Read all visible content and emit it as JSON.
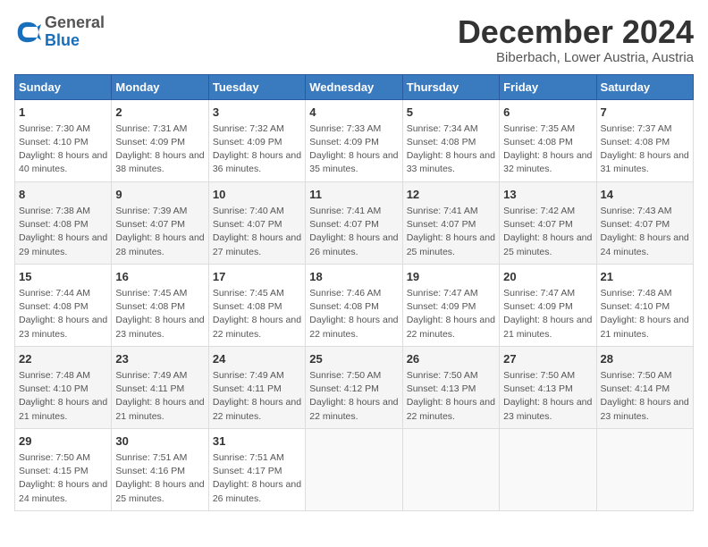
{
  "header": {
    "logo": {
      "general": "General",
      "blue": "Blue"
    },
    "title": "December 2024",
    "subtitle": "Biberbach, Lower Austria, Austria"
  },
  "calendar": {
    "days_of_week": [
      "Sunday",
      "Monday",
      "Tuesday",
      "Wednesday",
      "Thursday",
      "Friday",
      "Saturday"
    ],
    "weeks": [
      [
        {
          "day": "1",
          "sunrise": "7:30 AM",
          "sunset": "4:10 PM",
          "daylight": "8 hours and 40 minutes."
        },
        {
          "day": "2",
          "sunrise": "7:31 AM",
          "sunset": "4:09 PM",
          "daylight": "8 hours and 38 minutes."
        },
        {
          "day": "3",
          "sunrise": "7:32 AM",
          "sunset": "4:09 PM",
          "daylight": "8 hours and 36 minutes."
        },
        {
          "day": "4",
          "sunrise": "7:33 AM",
          "sunset": "4:09 PM",
          "daylight": "8 hours and 35 minutes."
        },
        {
          "day": "5",
          "sunrise": "7:34 AM",
          "sunset": "4:08 PM",
          "daylight": "8 hours and 33 minutes."
        },
        {
          "day": "6",
          "sunrise": "7:35 AM",
          "sunset": "4:08 PM",
          "daylight": "8 hours and 32 minutes."
        },
        {
          "day": "7",
          "sunrise": "7:37 AM",
          "sunset": "4:08 PM",
          "daylight": "8 hours and 31 minutes."
        }
      ],
      [
        {
          "day": "8",
          "sunrise": "7:38 AM",
          "sunset": "4:08 PM",
          "daylight": "8 hours and 29 minutes."
        },
        {
          "day": "9",
          "sunrise": "7:39 AM",
          "sunset": "4:07 PM",
          "daylight": "8 hours and 28 minutes."
        },
        {
          "day": "10",
          "sunrise": "7:40 AM",
          "sunset": "4:07 PM",
          "daylight": "8 hours and 27 minutes."
        },
        {
          "day": "11",
          "sunrise": "7:41 AM",
          "sunset": "4:07 PM",
          "daylight": "8 hours and 26 minutes."
        },
        {
          "day": "12",
          "sunrise": "7:41 AM",
          "sunset": "4:07 PM",
          "daylight": "8 hours and 25 minutes."
        },
        {
          "day": "13",
          "sunrise": "7:42 AM",
          "sunset": "4:07 PM",
          "daylight": "8 hours and 25 minutes."
        },
        {
          "day": "14",
          "sunrise": "7:43 AM",
          "sunset": "4:07 PM",
          "daylight": "8 hours and 24 minutes."
        }
      ],
      [
        {
          "day": "15",
          "sunrise": "7:44 AM",
          "sunset": "4:08 PM",
          "daylight": "8 hours and 23 minutes."
        },
        {
          "day": "16",
          "sunrise": "7:45 AM",
          "sunset": "4:08 PM",
          "daylight": "8 hours and 23 minutes."
        },
        {
          "day": "17",
          "sunrise": "7:45 AM",
          "sunset": "4:08 PM",
          "daylight": "8 hours and 22 minutes."
        },
        {
          "day": "18",
          "sunrise": "7:46 AM",
          "sunset": "4:08 PM",
          "daylight": "8 hours and 22 minutes."
        },
        {
          "day": "19",
          "sunrise": "7:47 AM",
          "sunset": "4:09 PM",
          "daylight": "8 hours and 22 minutes."
        },
        {
          "day": "20",
          "sunrise": "7:47 AM",
          "sunset": "4:09 PM",
          "daylight": "8 hours and 21 minutes."
        },
        {
          "day": "21",
          "sunrise": "7:48 AM",
          "sunset": "4:10 PM",
          "daylight": "8 hours and 21 minutes."
        }
      ],
      [
        {
          "day": "22",
          "sunrise": "7:48 AM",
          "sunset": "4:10 PM",
          "daylight": "8 hours and 21 minutes."
        },
        {
          "day": "23",
          "sunrise": "7:49 AM",
          "sunset": "4:11 PM",
          "daylight": "8 hours and 21 minutes."
        },
        {
          "day": "24",
          "sunrise": "7:49 AM",
          "sunset": "4:11 PM",
          "daylight": "8 hours and 22 minutes."
        },
        {
          "day": "25",
          "sunrise": "7:50 AM",
          "sunset": "4:12 PM",
          "daylight": "8 hours and 22 minutes."
        },
        {
          "day": "26",
          "sunrise": "7:50 AM",
          "sunset": "4:13 PM",
          "daylight": "8 hours and 22 minutes."
        },
        {
          "day": "27",
          "sunrise": "7:50 AM",
          "sunset": "4:13 PM",
          "daylight": "8 hours and 23 minutes."
        },
        {
          "day": "28",
          "sunrise": "7:50 AM",
          "sunset": "4:14 PM",
          "daylight": "8 hours and 23 minutes."
        }
      ],
      [
        {
          "day": "29",
          "sunrise": "7:50 AM",
          "sunset": "4:15 PM",
          "daylight": "8 hours and 24 minutes."
        },
        {
          "day": "30",
          "sunrise": "7:51 AM",
          "sunset": "4:16 PM",
          "daylight": "8 hours and 25 minutes."
        },
        {
          "day": "31",
          "sunrise": "7:51 AM",
          "sunset": "4:17 PM",
          "daylight": "8 hours and 26 minutes."
        },
        null,
        null,
        null,
        null
      ]
    ],
    "labels": {
      "sunrise": "Sunrise:",
      "sunset": "Sunset:",
      "daylight": "Daylight:"
    }
  }
}
